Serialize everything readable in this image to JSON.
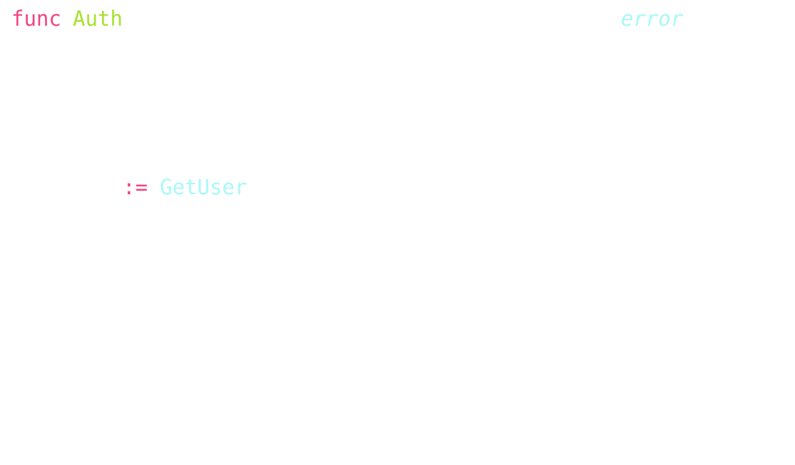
{
  "code": {
    "line1": {
      "keyword": "func",
      "function_name": "Auth",
      "return_type": "error"
    },
    "line2": {
      "operator": ":=",
      "call": "GetUser"
    }
  },
  "colors": {
    "keyword": "#F2457E",
    "function_name": "#A6E22E",
    "type": "#A9F8F8",
    "operator": "#F2457E",
    "call": "#A9F8F8",
    "background": "#ffffff"
  }
}
